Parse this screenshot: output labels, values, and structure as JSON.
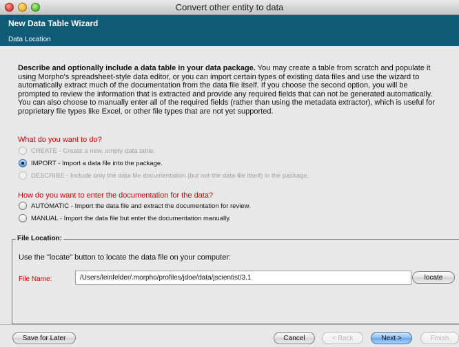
{
  "window": {
    "title": "Convert other entity to data"
  },
  "wizard": {
    "title": "New Data Table Wizard",
    "subtitle": "Data Location"
  },
  "description": {
    "bold_lead": "Describe and optionally include a data table in your data package.",
    "body": " You may create a table from scratch and populate it using Morpho's spreadsheet-style data editor, or you can import certain types of existing data files and use the wizard to automatically extract much of the documentation from the data file itself. If you choose the second option, you will be prompted to review the information that is extracted and provide any required fields that can not be generated automatically.",
    "body2": "You can also choose to manually enter all of the required fields (rather than using the metadata extractor), which is useful for proprietary file types like Excel, or other file types that are not yet supported."
  },
  "question1": {
    "label": "What do you want to do?",
    "options": [
      {
        "label": "CREATE - Create a new, empty data table.",
        "state": "disabled"
      },
      {
        "label": "IMPORT - Import a data file into the package.",
        "state": "selected"
      },
      {
        "label": "DESCRIBE - Include only the data file documentation (but not the data file itself) in the package.",
        "state": "disabled"
      }
    ]
  },
  "question2": {
    "label": "How do you want to enter the documentation for the data?",
    "options": [
      {
        "label": "AUTOMATIC - Import the data file and extract the documentation for review.",
        "state": "unselected"
      },
      {
        "label": "MANUAL - Import the data file but enter the documentation manually.",
        "state": "unselected"
      }
    ]
  },
  "file_location": {
    "group_title": "File Location:",
    "hint": "Use the \"locate\" button to locate the data file on your computer:",
    "file_label": "File Name:",
    "file_value": "/Users/leinfelder/.morpho/profiles/jdoe/data/jscientist/3.1",
    "locate_label": "locate"
  },
  "buttons": {
    "save_for_later": "Save for Later",
    "cancel": "Cancel",
    "back": "< Back",
    "next": "Next >",
    "finish": "Finish"
  },
  "colors": {
    "header_bg": "#0f5b78",
    "question_red": "#d10000",
    "selected_radio": "#5e9be3"
  }
}
